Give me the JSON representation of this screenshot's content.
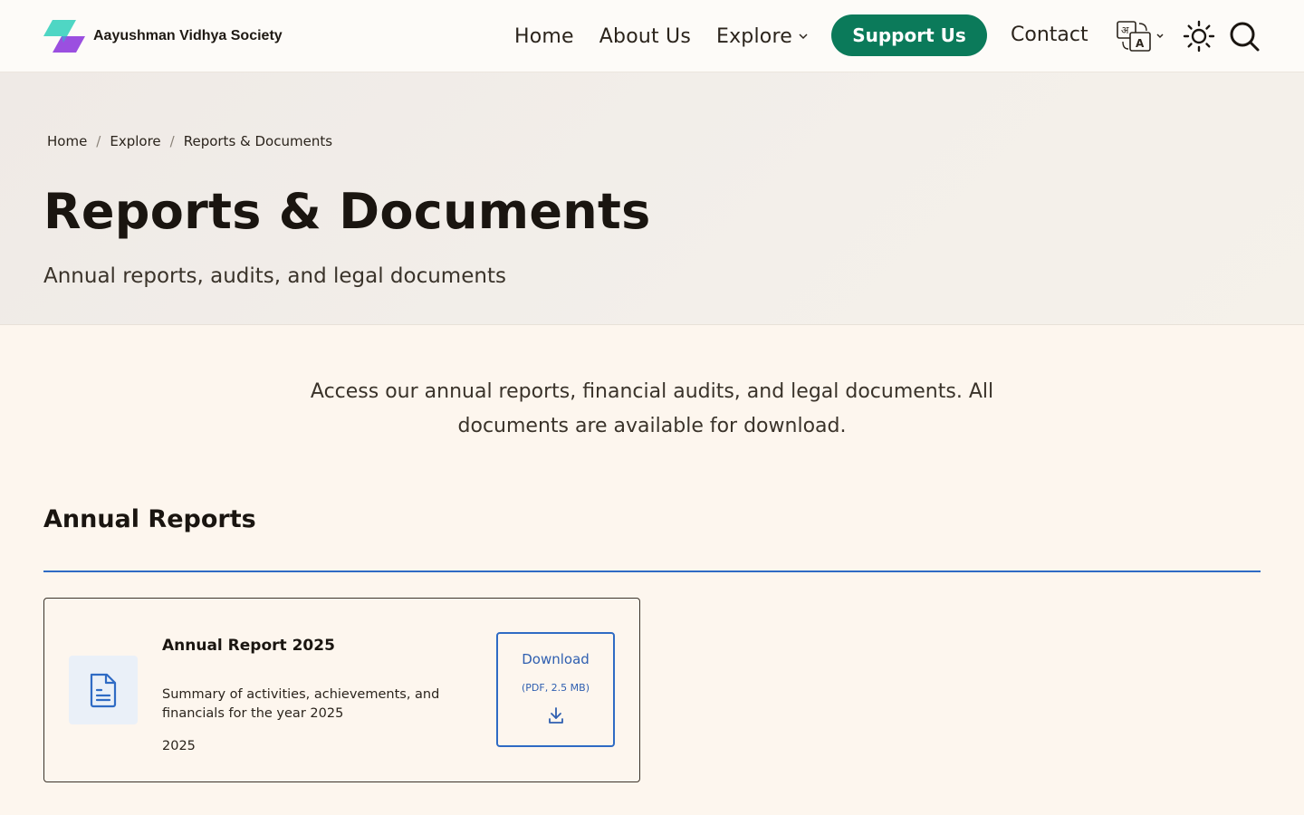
{
  "header": {
    "brand_name": "Aayushman Vidhya Society",
    "nav": {
      "home": "Home",
      "about": "About Us",
      "explore": "Explore",
      "support": "Support Us",
      "contact": "Contact"
    },
    "lang_icon": "language-translate-icon",
    "theme_icon": "sun-icon",
    "search_icon": "search-icon"
  },
  "breadcrumb": {
    "items": [
      "Home",
      "Explore",
      "Reports & Documents"
    ],
    "separator": "/"
  },
  "hero": {
    "title": "Reports & Documents",
    "subtitle": "Annual reports, audits, and legal documents"
  },
  "intro": {
    "text": "Access our annual reports, financial audits, and legal documents. All documents are available for download."
  },
  "sections": [
    {
      "title": "Annual Reports",
      "documents": [
        {
          "title": "Annual Report 2025",
          "description": "Summary of activities, achievements, and financials for the year 2025",
          "year": "2025",
          "download_label": "Download",
          "download_meta": "(PDF, 2.5 MB)"
        }
      ]
    }
  ],
  "colors": {
    "accent_green": "#0b7a5a",
    "accent_blue": "#2f6bc4",
    "background": "#fdf6ee"
  }
}
